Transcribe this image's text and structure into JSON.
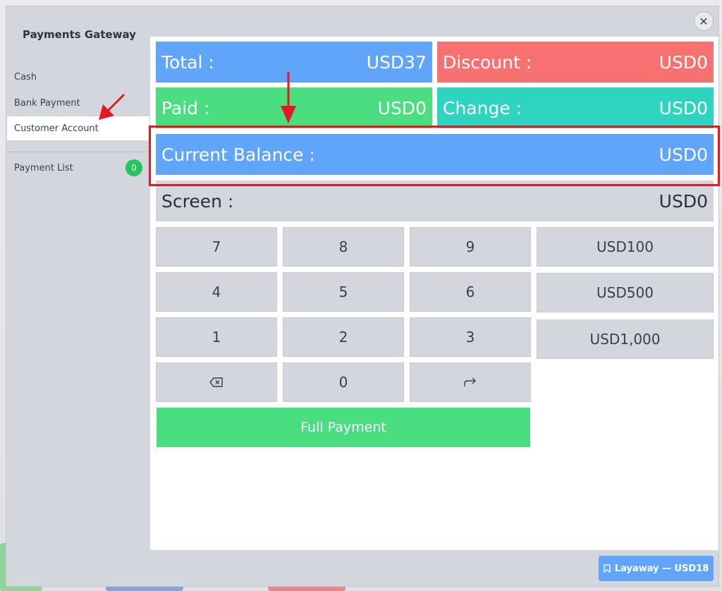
{
  "sidebar": {
    "title": "Payments Gateway",
    "items": [
      {
        "label": "Cash"
      },
      {
        "label": "Bank Payment"
      },
      {
        "label": "Customer Account"
      }
    ],
    "payment_list": {
      "label": "Payment List",
      "count": "0"
    }
  },
  "stats": {
    "total": {
      "label": "Total :",
      "value": "USD37",
      "color": "#60a5fa"
    },
    "discount": {
      "label": "Discount :",
      "value": "USD0",
      "color": "#f87171"
    },
    "paid": {
      "label": "Paid :",
      "value": "USD0",
      "color": "#4ade80"
    },
    "change": {
      "label": "Change :",
      "value": "USD0",
      "color": "#2dd4bf"
    },
    "current_balance": {
      "label": "Current Balance :",
      "value": "USD0",
      "color": "#60a5fa"
    },
    "screen": {
      "label": "Screen :",
      "value": "USD0"
    }
  },
  "keypad": {
    "digits": [
      "7",
      "8",
      "9",
      "4",
      "5",
      "6",
      "1",
      "2",
      "3"
    ],
    "zero": "0",
    "backspace_icon": "backspace-icon",
    "enter_icon": "redo-arrow-icon",
    "presets": [
      "USD100",
      "USD500",
      "USD1,000"
    ],
    "full_payment": "Full Payment"
  },
  "footer": {
    "layaway": "Layaway — USD18",
    "layaway_icon": "bookmark-icon"
  },
  "close_icon": "close-icon",
  "annotation_color": "#e5171f"
}
